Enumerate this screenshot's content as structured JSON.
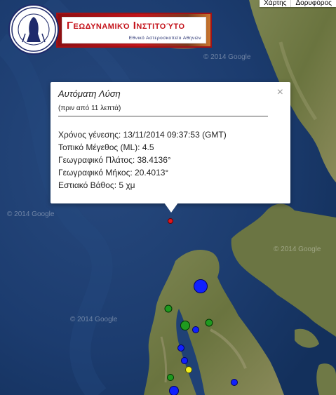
{
  "map_type": {
    "map_label": "Χάρτης",
    "satellite_label": "Δορυφόρος"
  },
  "logo": {
    "title": "Γεωδυναμικό Ινστιτούτο",
    "subtitle": "Εθνικό Αστεροσκοπείο Αθηνών",
    "seal_text": "Εθνικόν Αστεροσκοπείον Αθηνών"
  },
  "infowindow": {
    "title": "Αυτόματη Λύση",
    "time_ago": "(πριν από 11 λεπτά)",
    "origin_time": "Χρόνος γένεσης: 13/11/2014  09:37:53 (GMT)",
    "magnitude": "Τοπικό Μέγεθος (ML): 4.5",
    "latitude": "Γεωγραφικό Πλάτος: 38.4136°",
    "longitude": "Γεωγραφικό Μήκος: 20.4013°",
    "depth": "Εστιακό Βάθος: 5 χμ",
    "close": "×"
  },
  "watermark": "© 2014 Google",
  "colors": {
    "sea": "#1b3a6b",
    "land": "#6f7a46",
    "marker_red": "#e0151b",
    "marker_blue": "#1020ff",
    "marker_green": "#1f9a1f",
    "marker_yellow": "#f2ef1a"
  }
}
